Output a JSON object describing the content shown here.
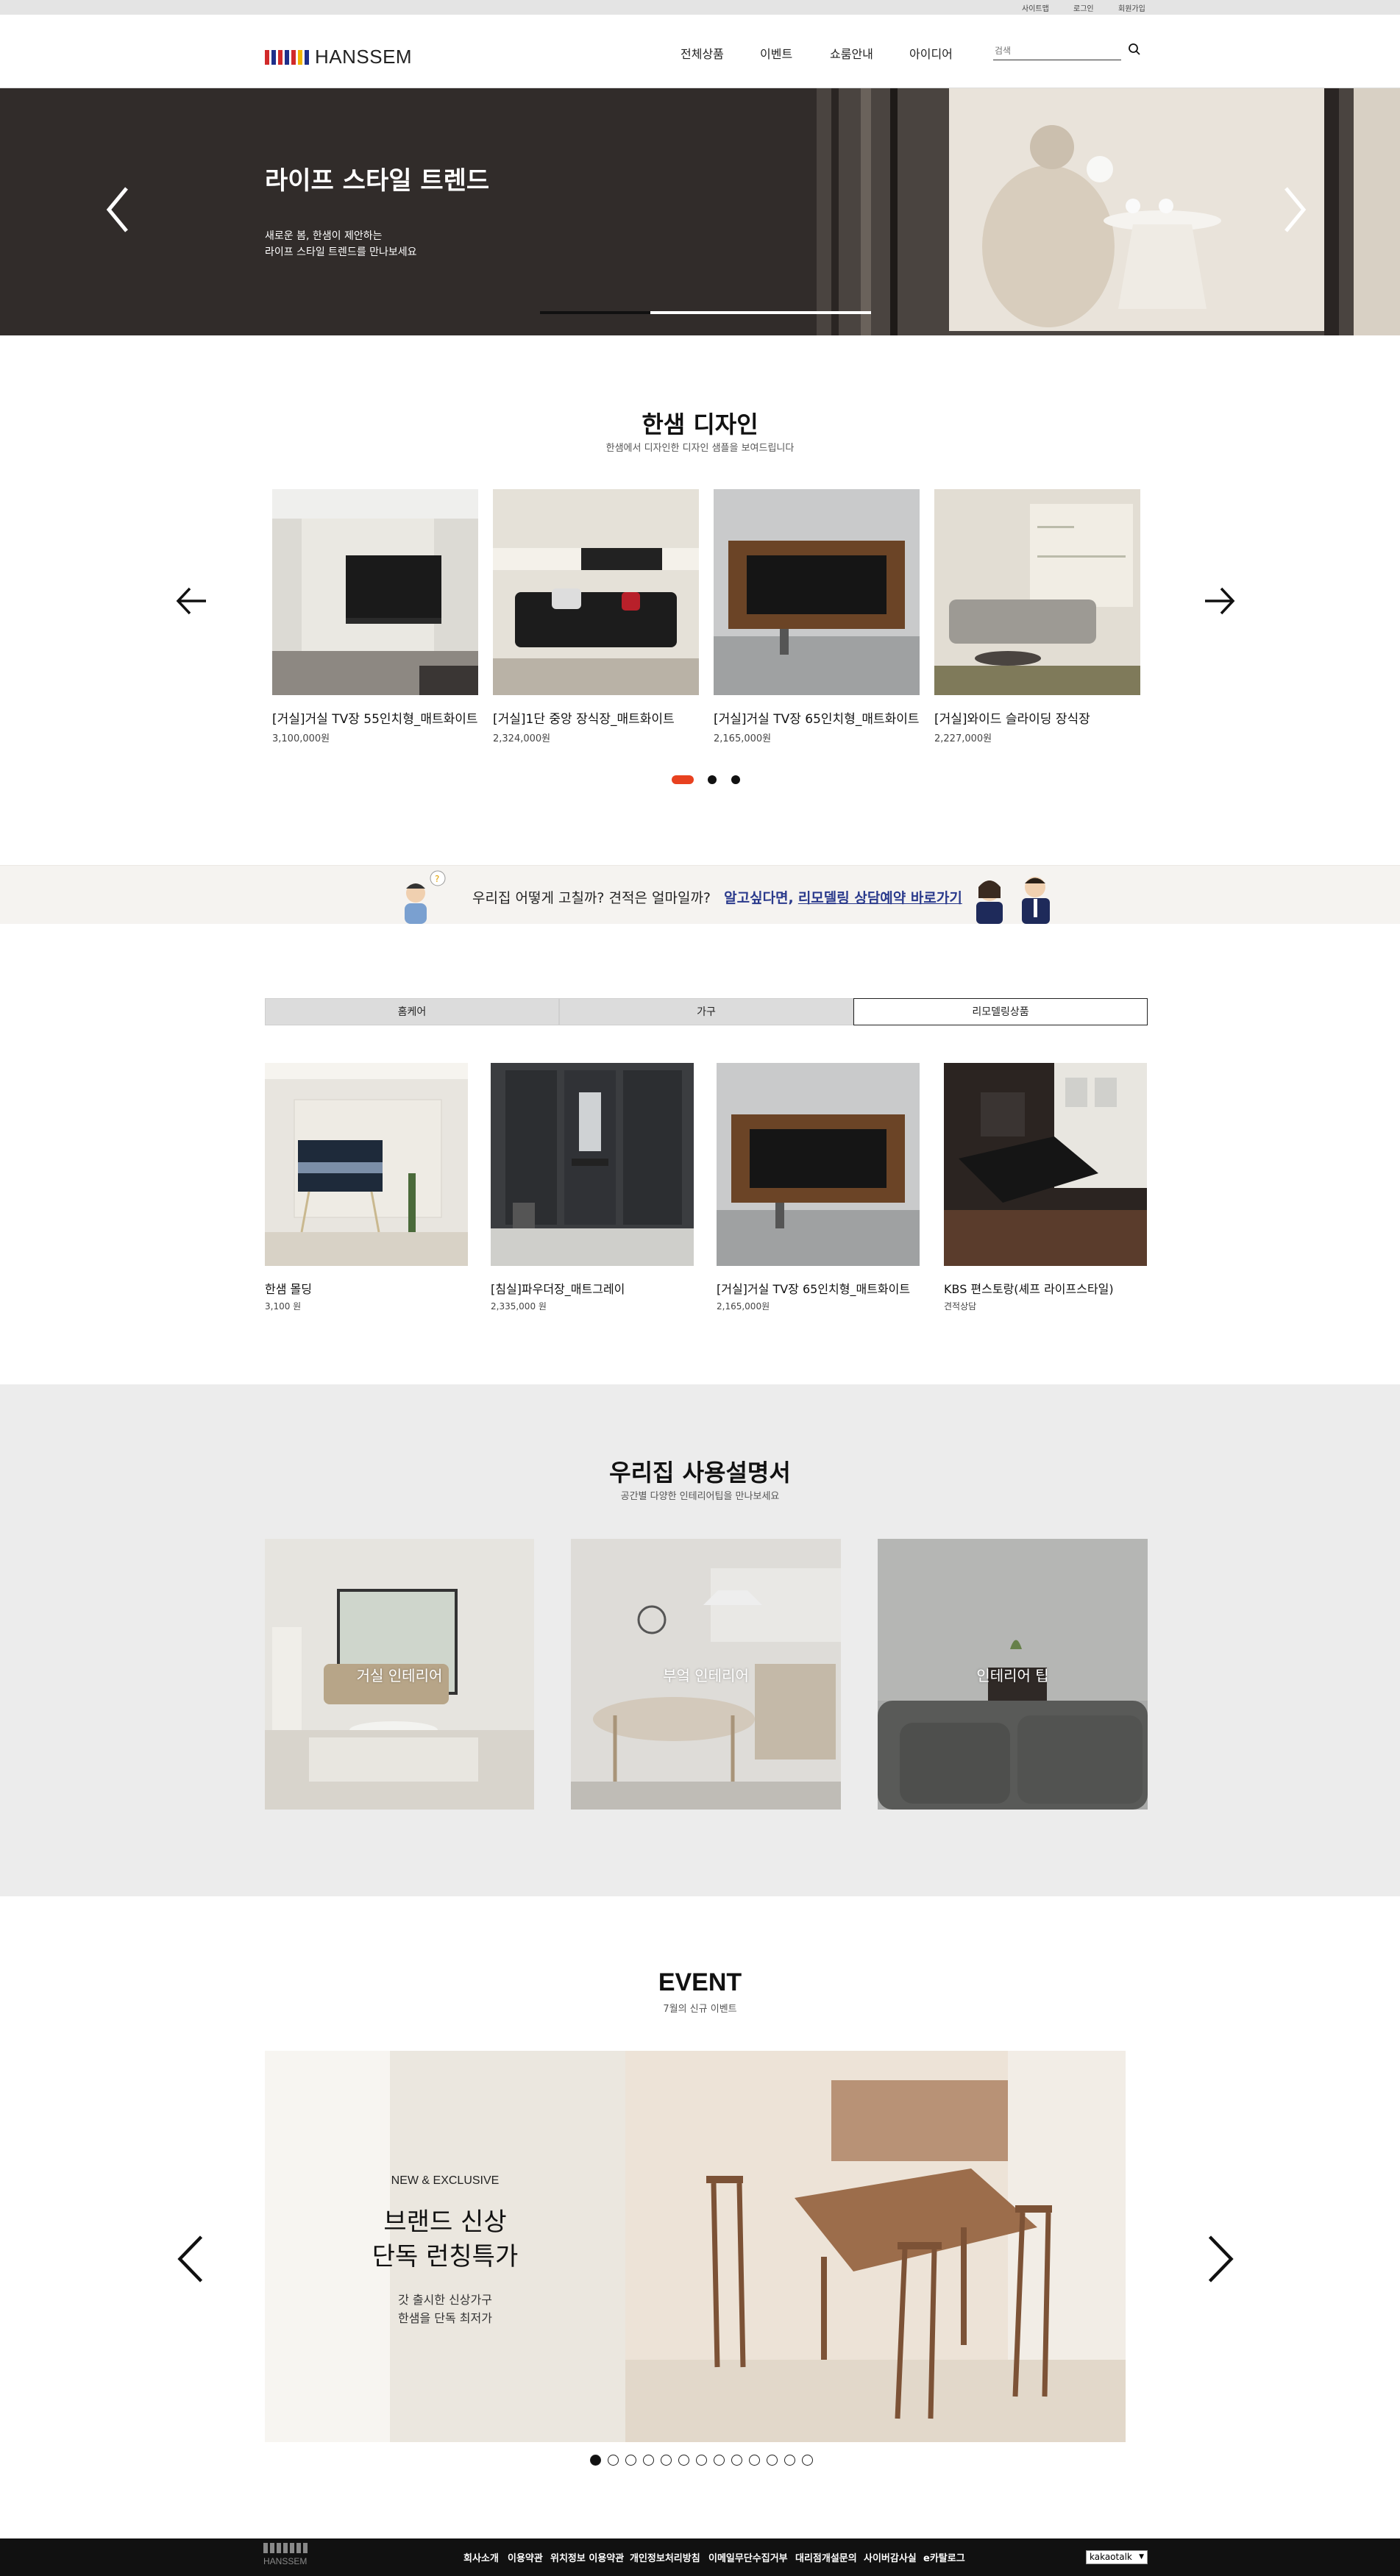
{
  "topbar": {
    "links": [
      "사이트맵",
      "로그인",
      "회원가입"
    ]
  },
  "header": {
    "logo_text": "HANSSEM",
    "nav": [
      "전체상품",
      "이벤트",
      "쇼룸안내",
      "아이디어"
    ],
    "search_placeholder": "검색"
  },
  "hero": {
    "title": "라이프 스타일 트렌드",
    "sub_line1": "새로운 봄, 한샘이 제안하는",
    "sub_line2": "라이프 스타일 트렌드를 만나보세요"
  },
  "design": {
    "title": "한샘 디자인",
    "subtitle": "한샘에서 디자인한 디자인 샘플을 보여드립니다",
    "products": [
      {
        "name": "[거실]거실 TV장 55인치형_매트화이트",
        "price": "3,100,000원"
      },
      {
        "name": "[거실]1단 중앙 장식장_매트화이트",
        "price": "2,324,000원"
      },
      {
        "name": "[거실]거실 TV장 65인치형_매트화이트",
        "price": "2,165,000원"
      },
      {
        "name": "[거실]와이드 슬라이딩 장식장",
        "price": "2,227,000원"
      }
    ]
  },
  "banner": {
    "text": "우리집 어떻게 고칠까?  견적은 얼마일까?",
    "link_prefix": "알고싶다면,",
    "link": "리모델링 상담예약 바로가기"
  },
  "tabs": [
    "홈케어",
    "가구",
    "리모델링상품"
  ],
  "remodel": {
    "products": [
      {
        "name": "한샘 몰딩",
        "price": "3,100 원"
      },
      {
        "name": "[침실]파우더장_매트그레이",
        "price": "2,335,000 원"
      },
      {
        "name": "[거실]거실 TV장 65인치형_매트화이트",
        "price": "2,165,000원"
      },
      {
        "name": "KBS 편스토랑(셰프 라이프스타일)",
        "price": "견적상담"
      }
    ]
  },
  "manual": {
    "title": "우리집 사용설명서",
    "subtitle": "공간별 다양한 인테리어팁을 만나보세요",
    "cards": [
      "거실 인테리어",
      "부엌 인테리어",
      "인테리어 팁"
    ]
  },
  "event": {
    "title": "EVENT",
    "subtitle": "7월의 신규 이벤트",
    "tag": "NEW & EXCLUSIVE",
    "headline1": "브랜드 신상",
    "headline2": "단독 런칭특가",
    "desc1": "갓 출시한 신상가구",
    "desc2": "한샘을 단독 최저가"
  },
  "footer": {
    "logo_text": "HANSSEM",
    "links": [
      "회사소개",
      "이용약관",
      "위치정보 이용약관",
      "개인정보처리방침",
      "이메일무단수집거부",
      "대리점개설문의",
      "사이버감사실",
      "e카탈로그"
    ],
    "select": "kakaotalk"
  }
}
